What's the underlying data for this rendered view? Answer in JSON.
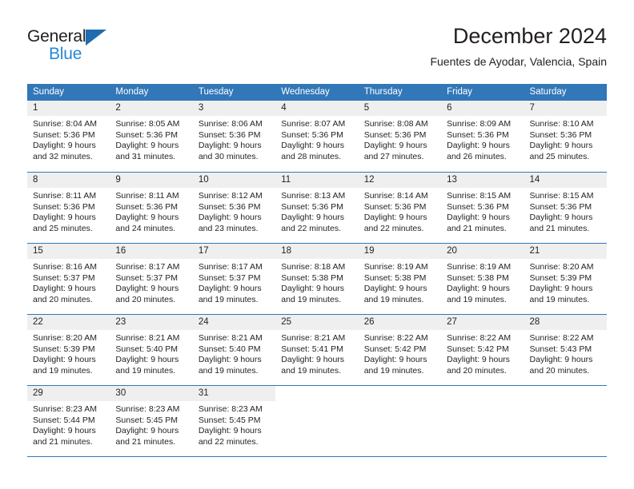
{
  "brand": {
    "name_part1": "General",
    "name_part2": "Blue",
    "accent_color": "#1f6cb0",
    "logo_blue_text_color": "#2787d8"
  },
  "header": {
    "title": "December 2024",
    "subtitle": "Fuentes de Ayodar, Valencia, Spain"
  },
  "calendar": {
    "header_bg_color": "#3277b8",
    "day_band_bg_color": "#efefef",
    "weekdays": [
      "Sunday",
      "Monday",
      "Tuesday",
      "Wednesday",
      "Thursday",
      "Friday",
      "Saturday"
    ],
    "weeks": [
      [
        {
          "day": "1",
          "sunrise": "Sunrise: 8:04 AM",
          "sunset": "Sunset: 5:36 PM",
          "daylight_line1": "Daylight: 9 hours",
          "daylight_line2": "and 32 minutes."
        },
        {
          "day": "2",
          "sunrise": "Sunrise: 8:05 AM",
          "sunset": "Sunset: 5:36 PM",
          "daylight_line1": "Daylight: 9 hours",
          "daylight_line2": "and 31 minutes."
        },
        {
          "day": "3",
          "sunrise": "Sunrise: 8:06 AM",
          "sunset": "Sunset: 5:36 PM",
          "daylight_line1": "Daylight: 9 hours",
          "daylight_line2": "and 30 minutes."
        },
        {
          "day": "4",
          "sunrise": "Sunrise: 8:07 AM",
          "sunset": "Sunset: 5:36 PM",
          "daylight_line1": "Daylight: 9 hours",
          "daylight_line2": "and 28 minutes."
        },
        {
          "day": "5",
          "sunrise": "Sunrise: 8:08 AM",
          "sunset": "Sunset: 5:36 PM",
          "daylight_line1": "Daylight: 9 hours",
          "daylight_line2": "and 27 minutes."
        },
        {
          "day": "6",
          "sunrise": "Sunrise: 8:09 AM",
          "sunset": "Sunset: 5:36 PM",
          "daylight_line1": "Daylight: 9 hours",
          "daylight_line2": "and 26 minutes."
        },
        {
          "day": "7",
          "sunrise": "Sunrise: 8:10 AM",
          "sunset": "Sunset: 5:36 PM",
          "daylight_line1": "Daylight: 9 hours",
          "daylight_line2": "and 25 minutes."
        }
      ],
      [
        {
          "day": "8",
          "sunrise": "Sunrise: 8:11 AM",
          "sunset": "Sunset: 5:36 PM",
          "daylight_line1": "Daylight: 9 hours",
          "daylight_line2": "and 25 minutes."
        },
        {
          "day": "9",
          "sunrise": "Sunrise: 8:11 AM",
          "sunset": "Sunset: 5:36 PM",
          "daylight_line1": "Daylight: 9 hours",
          "daylight_line2": "and 24 minutes."
        },
        {
          "day": "10",
          "sunrise": "Sunrise: 8:12 AM",
          "sunset": "Sunset: 5:36 PM",
          "daylight_line1": "Daylight: 9 hours",
          "daylight_line2": "and 23 minutes."
        },
        {
          "day": "11",
          "sunrise": "Sunrise: 8:13 AM",
          "sunset": "Sunset: 5:36 PM",
          "daylight_line1": "Daylight: 9 hours",
          "daylight_line2": "and 22 minutes."
        },
        {
          "day": "12",
          "sunrise": "Sunrise: 8:14 AM",
          "sunset": "Sunset: 5:36 PM",
          "daylight_line1": "Daylight: 9 hours",
          "daylight_line2": "and 22 minutes."
        },
        {
          "day": "13",
          "sunrise": "Sunrise: 8:15 AM",
          "sunset": "Sunset: 5:36 PM",
          "daylight_line1": "Daylight: 9 hours",
          "daylight_line2": "and 21 minutes."
        },
        {
          "day": "14",
          "sunrise": "Sunrise: 8:15 AM",
          "sunset": "Sunset: 5:36 PM",
          "daylight_line1": "Daylight: 9 hours",
          "daylight_line2": "and 21 minutes."
        }
      ],
      [
        {
          "day": "15",
          "sunrise": "Sunrise: 8:16 AM",
          "sunset": "Sunset: 5:37 PM",
          "daylight_line1": "Daylight: 9 hours",
          "daylight_line2": "and 20 minutes."
        },
        {
          "day": "16",
          "sunrise": "Sunrise: 8:17 AM",
          "sunset": "Sunset: 5:37 PM",
          "daylight_line1": "Daylight: 9 hours",
          "daylight_line2": "and 20 minutes."
        },
        {
          "day": "17",
          "sunrise": "Sunrise: 8:17 AM",
          "sunset": "Sunset: 5:37 PM",
          "daylight_line1": "Daylight: 9 hours",
          "daylight_line2": "and 19 minutes."
        },
        {
          "day": "18",
          "sunrise": "Sunrise: 8:18 AM",
          "sunset": "Sunset: 5:38 PM",
          "daylight_line1": "Daylight: 9 hours",
          "daylight_line2": "and 19 minutes."
        },
        {
          "day": "19",
          "sunrise": "Sunrise: 8:19 AM",
          "sunset": "Sunset: 5:38 PM",
          "daylight_line1": "Daylight: 9 hours",
          "daylight_line2": "and 19 minutes."
        },
        {
          "day": "20",
          "sunrise": "Sunrise: 8:19 AM",
          "sunset": "Sunset: 5:38 PM",
          "daylight_line1": "Daylight: 9 hours",
          "daylight_line2": "and 19 minutes."
        },
        {
          "day": "21",
          "sunrise": "Sunrise: 8:20 AM",
          "sunset": "Sunset: 5:39 PM",
          "daylight_line1": "Daylight: 9 hours",
          "daylight_line2": "and 19 minutes."
        }
      ],
      [
        {
          "day": "22",
          "sunrise": "Sunrise: 8:20 AM",
          "sunset": "Sunset: 5:39 PM",
          "daylight_line1": "Daylight: 9 hours",
          "daylight_line2": "and 19 minutes."
        },
        {
          "day": "23",
          "sunrise": "Sunrise: 8:21 AM",
          "sunset": "Sunset: 5:40 PM",
          "daylight_line1": "Daylight: 9 hours",
          "daylight_line2": "and 19 minutes."
        },
        {
          "day": "24",
          "sunrise": "Sunrise: 8:21 AM",
          "sunset": "Sunset: 5:40 PM",
          "daylight_line1": "Daylight: 9 hours",
          "daylight_line2": "and 19 minutes."
        },
        {
          "day": "25",
          "sunrise": "Sunrise: 8:21 AM",
          "sunset": "Sunset: 5:41 PM",
          "daylight_line1": "Daylight: 9 hours",
          "daylight_line2": "and 19 minutes."
        },
        {
          "day": "26",
          "sunrise": "Sunrise: 8:22 AM",
          "sunset": "Sunset: 5:42 PM",
          "daylight_line1": "Daylight: 9 hours",
          "daylight_line2": "and 19 minutes."
        },
        {
          "day": "27",
          "sunrise": "Sunrise: 8:22 AM",
          "sunset": "Sunset: 5:42 PM",
          "daylight_line1": "Daylight: 9 hours",
          "daylight_line2": "and 20 minutes."
        },
        {
          "day": "28",
          "sunrise": "Sunrise: 8:22 AM",
          "sunset": "Sunset: 5:43 PM",
          "daylight_line1": "Daylight: 9 hours",
          "daylight_line2": "and 20 minutes."
        }
      ],
      [
        {
          "day": "29",
          "sunrise": "Sunrise: 8:23 AM",
          "sunset": "Sunset: 5:44 PM",
          "daylight_line1": "Daylight: 9 hours",
          "daylight_line2": "and 21 minutes."
        },
        {
          "day": "30",
          "sunrise": "Sunrise: 8:23 AM",
          "sunset": "Sunset: 5:45 PM",
          "daylight_line1": "Daylight: 9 hours",
          "daylight_line2": "and 21 minutes."
        },
        {
          "day": "31",
          "sunrise": "Sunrise: 8:23 AM",
          "sunset": "Sunset: 5:45 PM",
          "daylight_line1": "Daylight: 9 hours",
          "daylight_line2": "and 22 minutes."
        },
        {
          "day": "",
          "sunrise": "",
          "sunset": "",
          "daylight_line1": "",
          "daylight_line2": ""
        },
        {
          "day": "",
          "sunrise": "",
          "sunset": "",
          "daylight_line1": "",
          "daylight_line2": ""
        },
        {
          "day": "",
          "sunrise": "",
          "sunset": "",
          "daylight_line1": "",
          "daylight_line2": ""
        },
        {
          "day": "",
          "sunrise": "",
          "sunset": "",
          "daylight_line1": "",
          "daylight_line2": ""
        }
      ]
    ]
  }
}
